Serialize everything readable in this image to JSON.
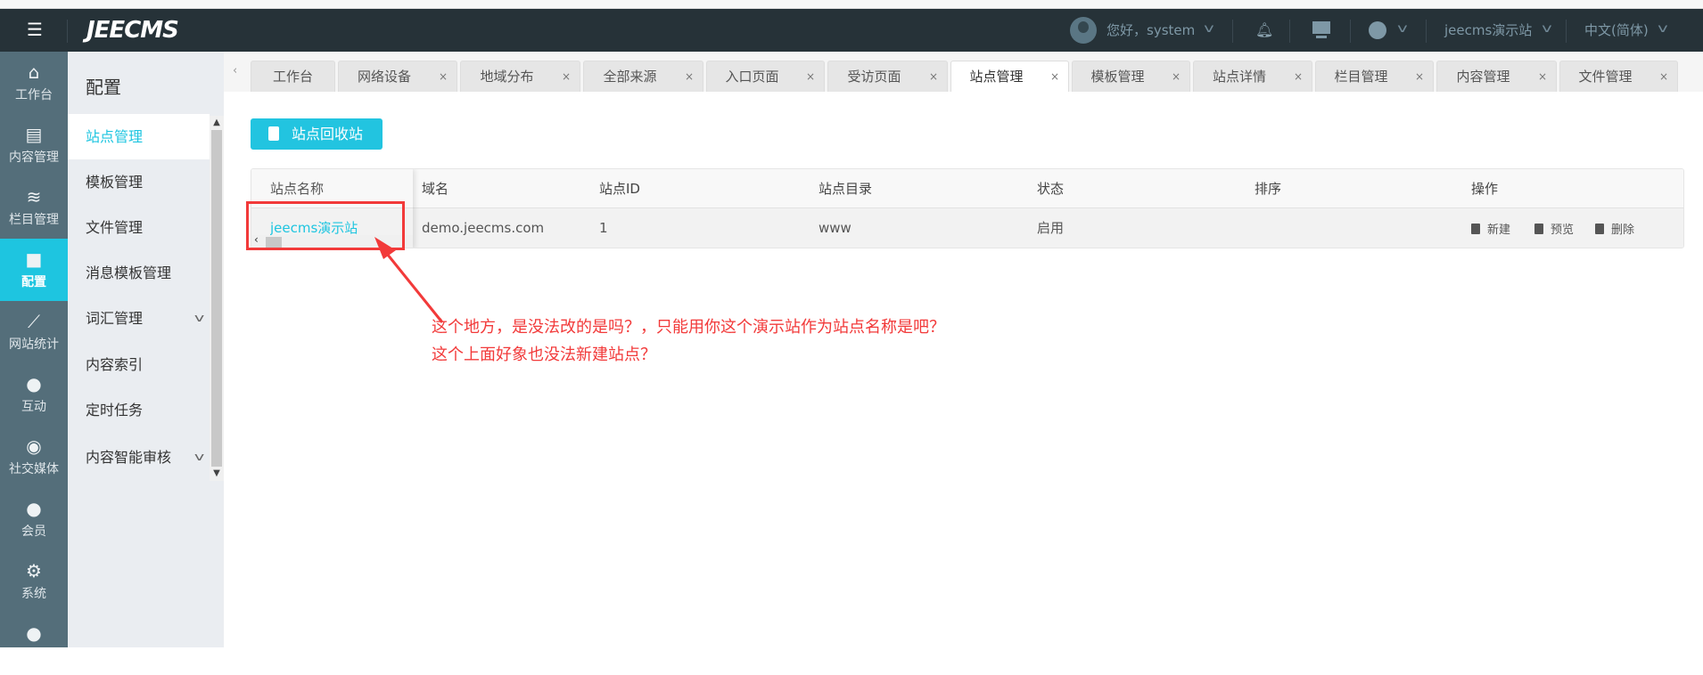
{
  "header": {
    "logo": "JEECMS",
    "greeting": "您好，system",
    "site": "jeecms演示站",
    "language": "中文(简体)"
  },
  "rail": [
    {
      "label": "工作台",
      "icon": "home-icon"
    },
    {
      "label": "内容管理",
      "icon": "document-icon"
    },
    {
      "label": "栏目管理",
      "icon": "layers-icon"
    },
    {
      "label": "配置",
      "icon": "cube-icon",
      "active": true
    },
    {
      "label": "网站统计",
      "icon": "chart-icon"
    },
    {
      "label": "互动",
      "icon": "chat-icon"
    },
    {
      "label": "社交媒体",
      "icon": "target-icon"
    },
    {
      "label": "会员",
      "icon": "member-icon"
    },
    {
      "label": "系统",
      "icon": "gear-icon"
    }
  ],
  "subnav": {
    "title": "配置",
    "items": [
      "站点管理",
      "模板管理",
      "文件管理",
      "消息模板管理",
      "词汇管理",
      "内容索引",
      "定时任务",
      "内容智能审核"
    ]
  },
  "tabs": [
    "工作台",
    "网络设备",
    "地域分布",
    "全部来源",
    "入口页面",
    "受访页面",
    "站点管理",
    "模板管理",
    "站点详情",
    "栏目管理",
    "内容管理",
    "文件管理"
  ],
  "main": {
    "recycle_button": "站点回收站",
    "table": {
      "headers": [
        "站点名称",
        "域名",
        "站点ID",
        "站点目录",
        "状态",
        "排序",
        "操作"
      ],
      "row": {
        "name": "jeecms演示站",
        "domain": "demo.jeecms.com",
        "id": "1",
        "dir": "www",
        "status": "启用",
        "sort": ""
      },
      "actions": [
        "新建",
        "预览",
        "删除"
      ]
    }
  },
  "annotation": {
    "line1": "这个地方，是没法改的是吗？，只能用你这个演示站作为站点名称是吧？",
    "line2": "这个上面好象也没法新建站点？"
  },
  "colors": {
    "accent": "#1ec5e0",
    "header": "#263238",
    "rail": "#546e7a",
    "annotation": "#f23a3a"
  }
}
